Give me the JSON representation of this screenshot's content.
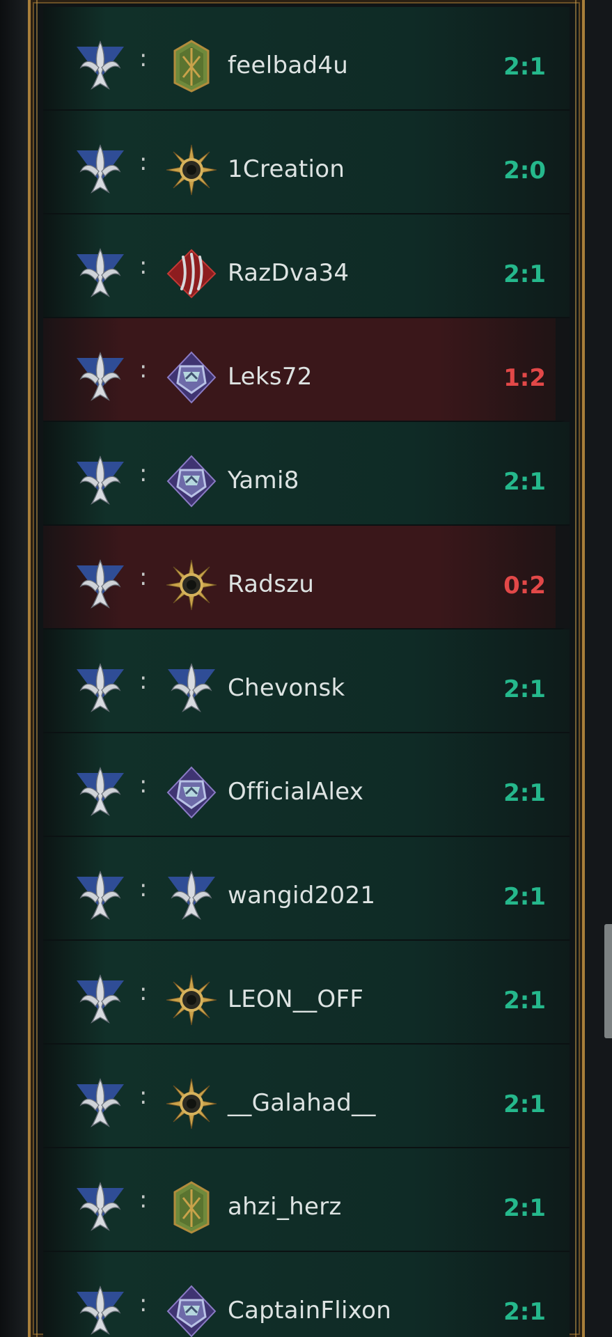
{
  "rows": [
    {
      "name": "feelbad4u",
      "score": "2:1",
      "result": "win",
      "opponent_icon": "green-shield-icon"
    },
    {
      "name": "1Creation",
      "score": "2:0",
      "result": "win",
      "opponent_icon": "sun-emblem-icon"
    },
    {
      "name": "RazDva34",
      "score": "2:1",
      "result": "win",
      "opponent_icon": "red-claw-icon"
    },
    {
      "name": "Leks72",
      "score": "1:2",
      "result": "loss",
      "opponent_icon": "purple-crest-icon"
    },
    {
      "name": "Yami8",
      "score": "2:1",
      "result": "win",
      "opponent_icon": "purple-crest-icon"
    },
    {
      "name": "Radszu",
      "score": "0:2",
      "result": "loss",
      "opponent_icon": "sun-emblem-icon"
    },
    {
      "name": "Chevonsk",
      "score": "2:1",
      "result": "win",
      "opponent_icon": "blue-lily-icon"
    },
    {
      "name": "OfficialAlex",
      "score": "2:1",
      "result": "win",
      "opponent_icon": "purple-crest-icon"
    },
    {
      "name": "wangid2021",
      "score": "2:1",
      "result": "win",
      "opponent_icon": "blue-lily-icon"
    },
    {
      "name": "LEON__OFF",
      "score": "2:1",
      "result": "win",
      "opponent_icon": "sun-emblem-icon"
    },
    {
      "name": "__Galahad__",
      "score": "2:1",
      "result": "win",
      "opponent_icon": "sun-emblem-icon"
    },
    {
      "name": "ahzi_herz",
      "score": "2:1",
      "result": "win",
      "opponent_icon": "green-shield-icon"
    },
    {
      "name": "CaptainFlixon",
      "score": "2:1",
      "result": "win",
      "opponent_icon": "purple-crest-icon"
    }
  ],
  "player_icon": "blue-lily-icon",
  "separator": ":",
  "colors": {
    "win_row": "#0f2b26",
    "loss_row": "#3a171a",
    "win_score": "#25b88c",
    "loss_score": "#e24848",
    "frame_gold": "#a77e3a"
  }
}
